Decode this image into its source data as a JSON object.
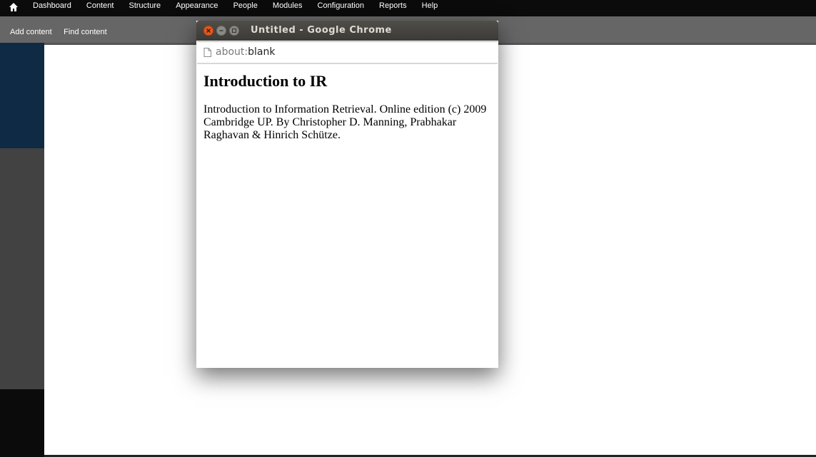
{
  "admin_toolbar": {
    "home_icon": "home-icon",
    "menu": [
      "Dashboard",
      "Content",
      "Structure",
      "Appearance",
      "People",
      "Modules",
      "Configuration",
      "Reports",
      "Help"
    ]
  },
  "shortcuts": [
    "Add content",
    "Find content"
  ],
  "popup": {
    "title": "Untitled - Google Chrome",
    "url_scheme": "about:",
    "url_path": "blank",
    "heading": "Introduction to IR",
    "body": "Introduction to Information Retrieval. Online edition (c) 2009 Cambridge UP. By Christopher D. Manning, Prabhakar Raghavan & Hinrich Schütze."
  },
  "colors": {
    "toolbar_bg": "#0b0b0b",
    "shortcut_bg": "#666666",
    "left_column_top": "#0e2a44",
    "left_column_mid": "#424242",
    "close_button": "#e2591f"
  }
}
